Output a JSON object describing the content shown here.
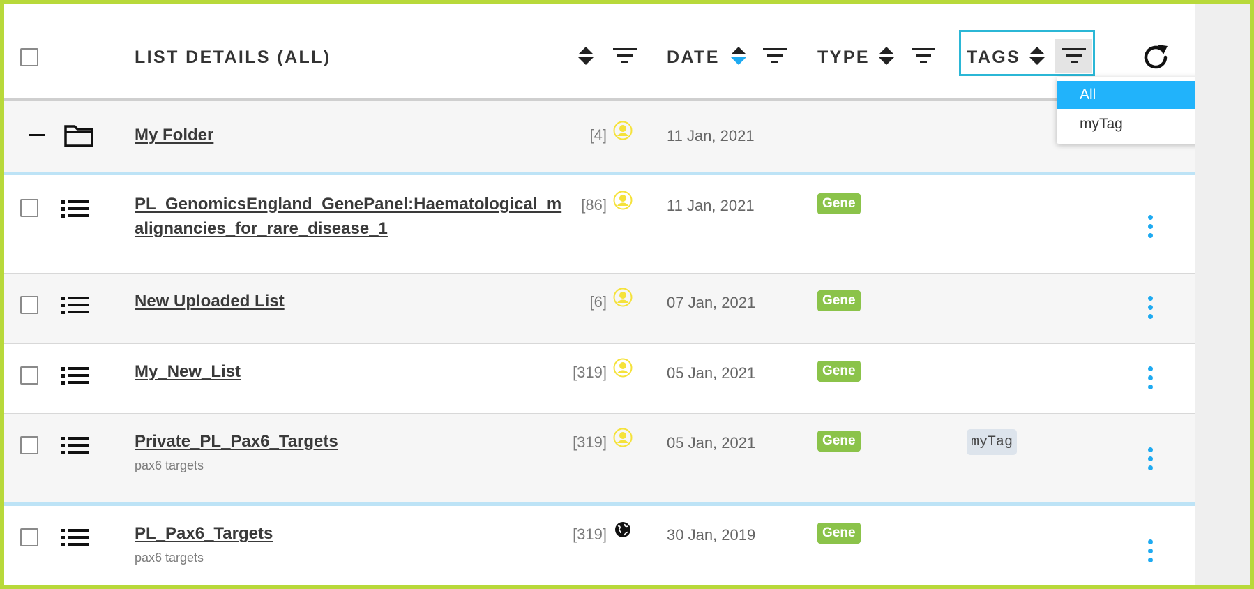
{
  "header": {
    "list_details_title": "LIST DETAILS (ALL)",
    "date_title": "DATE",
    "type_title": "TYPE",
    "tags_title": "TAGS"
  },
  "tags_dropdown": {
    "options": [
      "All",
      "myTag"
    ],
    "selected": "All"
  },
  "rows": [
    {
      "kind": "folder",
      "name": "My Folder",
      "count": "[4]",
      "owner": "user-icon",
      "date": "11 Jan, 2021"
    },
    {
      "kind": "list",
      "name_line1": "PL_GenomicsEngland_GenePanel:Haematological_m",
      "name_line2": "alignancies_for_rare_disease_1",
      "count": "[86]",
      "owner": "user-icon",
      "date": "11 Jan, 2021",
      "type": "Gene"
    },
    {
      "kind": "list",
      "name": "New Uploaded List",
      "count": "[6]",
      "owner": "user-icon",
      "date": "07 Jan, 2021",
      "type": "Gene"
    },
    {
      "kind": "list",
      "name": "My_New_List",
      "count": "[319]",
      "owner": "user-icon",
      "date": "05 Jan, 2021",
      "type": "Gene"
    },
    {
      "kind": "list",
      "name": "Private_PL_Pax6_Targets",
      "description": "pax6 targets",
      "count": "[319]",
      "owner": "user-icon",
      "date": "05 Jan, 2021",
      "type": "Gene",
      "tag": "myTag"
    },
    {
      "kind": "list",
      "name": "PL_Pax6_Targets",
      "description": "pax6 targets",
      "count": "[319]",
      "owner": "globe-icon",
      "date": "30 Jan, 2019",
      "type": "Gene"
    }
  ],
  "colors": {
    "accent": "#1eaaf1",
    "badge": "#8bc34a",
    "highlight_border": "#2bb7d6",
    "outer_border": "#b8d93a",
    "owner_icon": "#f5e23a"
  }
}
